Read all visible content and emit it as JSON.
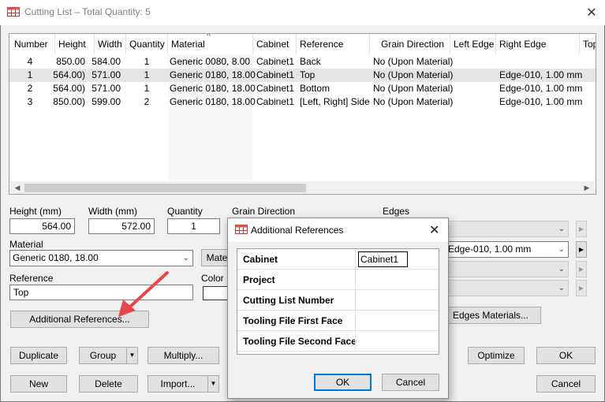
{
  "window": {
    "title": "Cutting List – Total Quantity: 5"
  },
  "list": {
    "columns": [
      "Number",
      "Height",
      "Width",
      "Quantity",
      "Material",
      "Cabinet",
      "Reference",
      "Grain Direction",
      "Left Edge",
      "Right Edge",
      "Top"
    ],
    "sort_indicator": "^",
    "rows": [
      [
        "4",
        "850.00",
        "584.00",
        "1",
        "Generic 0080, 8.00",
        "Cabinet1",
        "Back",
        "No (Upon Material)",
        "",
        ""
      ],
      [
        "1",
        "564.00)",
        "571.00",
        "1",
        "Generic 0180, 18.00",
        "Cabinet1",
        "Top",
        "No (Upon Material)",
        "",
        "Edge-010, 1.00 mm"
      ],
      [
        "2",
        "564.00)",
        "571.00",
        "1",
        "Generic 0180, 18.00",
        "Cabinet1",
        "Bottom",
        "No (Upon Material)",
        "",
        "Edge-010, 1.00 mm"
      ],
      [
        "3",
        "850.00)",
        "599.00",
        "2",
        "Generic 0180, 18.00",
        "Cabinet1",
        "[Left, Right] Side",
        "No (Upon Material)",
        "",
        "Edge-010, 1.00 mm"
      ]
    ],
    "selected_row": 1
  },
  "form": {
    "height_label": "Height (mm)",
    "height_value": "564.00",
    "width_label": "Width (mm)",
    "width_value": "572.00",
    "quantity_label": "Quantity",
    "quantity_value": "1",
    "grain_label": "Grain Direction",
    "edges_label": "Edges",
    "material_label": "Material",
    "material_value": "Generic 0180, 18.00",
    "material_button": "Mate",
    "reference_label": "Reference",
    "reference_value": "Top",
    "color_label": "Color",
    "additional_refs_button": "Additional References...",
    "edge_right_value": "Edge-010, 1.00 mm",
    "edges_materials_button": "Edges Materials..."
  },
  "buttons": {
    "duplicate": "Duplicate",
    "group": "Group",
    "multiply": "Multiply...",
    "new": "New",
    "delete": "Delete",
    "import": "Import...",
    "optimize": "Optimize",
    "ok": "OK",
    "cancel": "Cancel"
  },
  "dialog": {
    "title": "Additional References",
    "rows": [
      {
        "key": "Cabinet",
        "value": "Cabinet1"
      },
      {
        "key": "Project",
        "value": ""
      },
      {
        "key": "Cutting List Number",
        "value": ""
      },
      {
        "key": "Tooling File First Face",
        "value": ""
      },
      {
        "key": "Tooling File Second Face",
        "value": ""
      }
    ],
    "ok": "OK",
    "cancel": "Cancel"
  },
  "colors": {
    "annotation_arrow": "#e8474a",
    "selection": "#e5e5e5",
    "accent": "#0078d7"
  }
}
